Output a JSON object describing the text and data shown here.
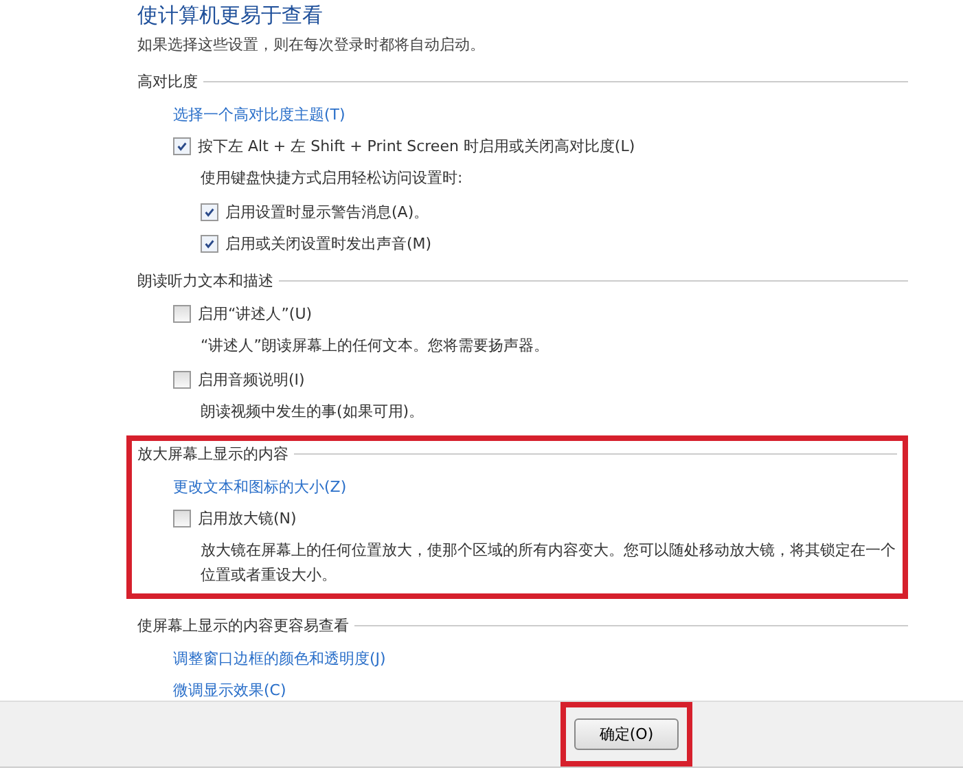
{
  "title": "使计算机更易于查看",
  "subtitle": "如果选择这些设置，则在每次登录时都将自动启动。",
  "sections": [
    {
      "heading": "高对比度",
      "highlighted": false,
      "items": [
        {
          "kind": "link",
          "text": "选择一个高对比度主题(T)"
        },
        {
          "kind": "checkbox",
          "text": "按下左 Alt + 左 Shift + Print Screen 时启用或关闭高对比度(L)",
          "checked": true,
          "children": [
            {
              "kind": "note",
              "text": "使用键盘快捷方式启用轻松访问设置时:"
            },
            {
              "kind": "checkbox",
              "text": "启用设置时显示警告消息(A)。",
              "checked": true
            },
            {
              "kind": "checkbox",
              "text": "启用或关闭设置时发出声音(M)",
              "checked": true
            }
          ]
        }
      ]
    },
    {
      "heading": "朗读听力文本和描述",
      "highlighted": false,
      "items": [
        {
          "kind": "checkbox",
          "text": "启用“讲述人”(U)",
          "checked": false,
          "children": [
            {
              "kind": "note",
              "text": "“讲述人”朗读屏幕上的任何文本。您将需要扬声器。"
            }
          ]
        },
        {
          "kind": "checkbox",
          "text": "启用音频说明(I)",
          "checked": false,
          "children": [
            {
              "kind": "note",
              "text": "朗读视频中发生的事(如果可用)。"
            }
          ]
        }
      ]
    },
    {
      "heading": "放大屏幕上显示的内容",
      "highlighted": true,
      "items": [
        {
          "kind": "link",
          "text": "更改文本和图标的大小(Z)"
        },
        {
          "kind": "checkbox",
          "text": "启用放大镜(N)",
          "checked": false,
          "children": [
            {
              "kind": "note",
              "text": "放大镜在屏幕上的任何位置放大，使那个区域的所有内容变大。您可以随处移动放大镜，将其锁定在一个位置或者重设大小。"
            }
          ]
        }
      ]
    },
    {
      "heading": "使屏幕上显示的内容更容易查看",
      "highlighted": false,
      "items": [
        {
          "kind": "link",
          "text": "调整窗口边框的颜色和透明度(J)"
        },
        {
          "kind": "link",
          "text": "微调显示效果(C)"
        }
      ]
    }
  ],
  "ok_button": {
    "label": "确定(O)",
    "highlighted": true
  }
}
